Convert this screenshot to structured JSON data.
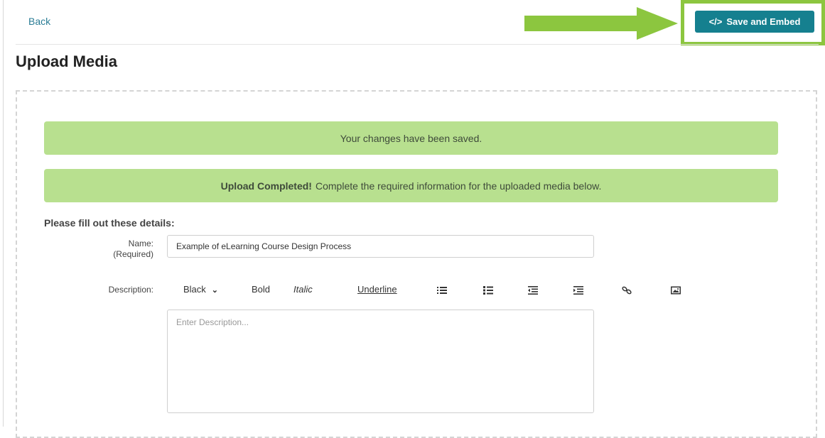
{
  "header": {
    "back_label": "Back",
    "save_label": "Save and Embed",
    "save_icon": "code-icon",
    "save_icon_glyph": "</>",
    "highlight_color": "#8cc63f",
    "accent_color": "#15808f"
  },
  "page": {
    "title": "Upload Media"
  },
  "alerts": {
    "saved": "Your changes have been saved.",
    "upload_strong": "Upload Completed!",
    "upload_text": "Complete the required information for the uploaded media below.",
    "color": "#b8e08f"
  },
  "form": {
    "section_label": "Please fill out these details:",
    "name_label": "Name:",
    "name_required": "(Required)",
    "name_value": "Example of eLearning Course Design Process",
    "description_label": "Description:",
    "description_placeholder": "Enter Description..."
  },
  "toolbar": {
    "color_label": "Black",
    "bold_label": "Bold",
    "italic_label": "Italic",
    "underline_label": "Underline",
    "icons": [
      "bulleted-list-icon",
      "numbered-list-icon",
      "outdent-icon",
      "indent-icon",
      "link-icon",
      "image-icon"
    ]
  }
}
